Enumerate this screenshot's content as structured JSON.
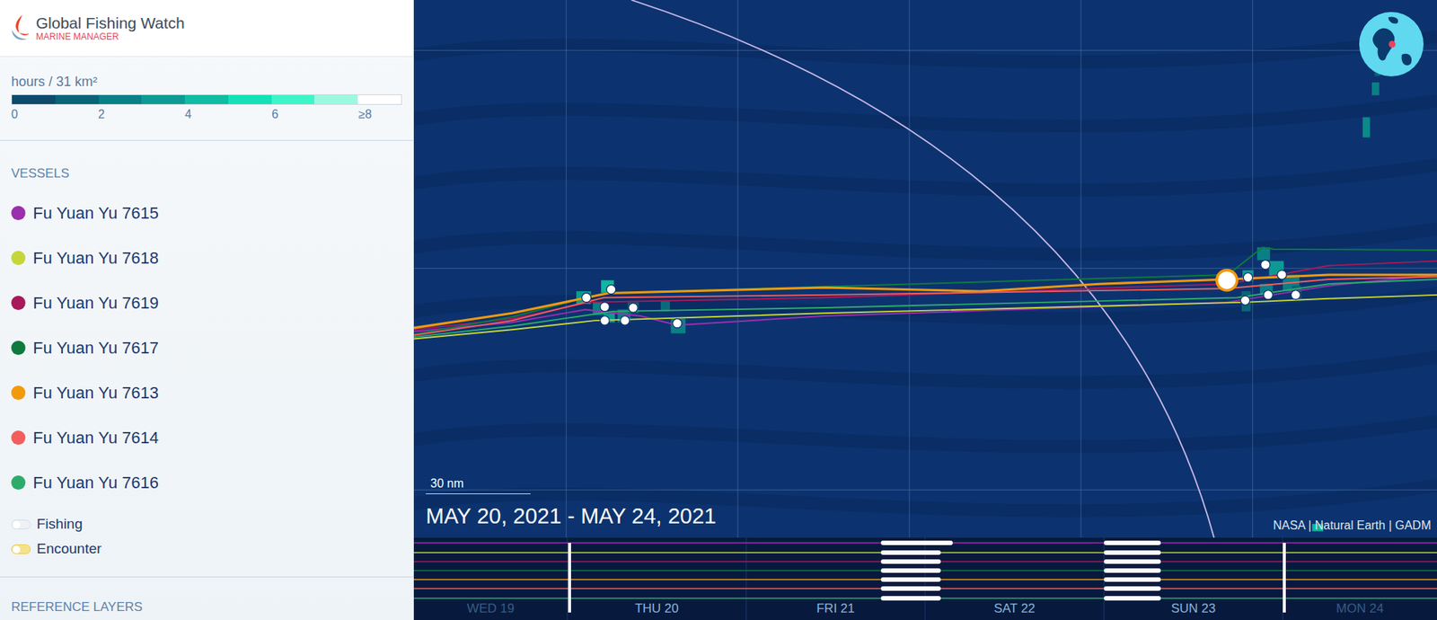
{
  "header": {
    "title": "Global Fishing Watch",
    "subtitle": "MARINE MANAGER"
  },
  "legend": {
    "unit": "hours / 31 km²",
    "ticks": [
      "0",
      "2",
      "4",
      "6",
      "≥8"
    ]
  },
  "vessels_heading": "VESSELS",
  "vessels": [
    {
      "name": "Fu Yuan Yu 7615",
      "color": "#9b2fae"
    },
    {
      "name": "Fu Yuan Yu 7618",
      "color": "#c6d63a"
    },
    {
      "name": "Fu Yuan Yu 7619",
      "color": "#a8195a"
    },
    {
      "name": "Fu Yuan Yu 7617",
      "color": "#0e7a3e"
    },
    {
      "name": "Fu Yuan Yu 7613",
      "color": "#f29a0c"
    },
    {
      "name": "Fu Yuan Yu 7614",
      "color": "#f25f5c"
    },
    {
      "name": "Fu Yuan Yu 7616",
      "color": "#2eab6a"
    }
  ],
  "toggles": [
    {
      "label": "Fishing",
      "on": false
    },
    {
      "label": "Encounter",
      "on": true
    }
  ],
  "reference_heading": "REFERENCE LAYERS",
  "map": {
    "date_range": "MAY 20, 2021 - MAY 24, 2021",
    "scale": "30 nm",
    "attribution": "NASA | Natural Earth | GADM"
  },
  "timeline": {
    "days": [
      {
        "label": "WED 19",
        "in_range": false
      },
      {
        "label": "THU 20",
        "in_range": true
      },
      {
        "label": "FRI 21",
        "in_range": true
      },
      {
        "label": "SAT 22",
        "in_range": true
      },
      {
        "label": "SUN 23",
        "in_range": true
      },
      {
        "label": "MON 24",
        "in_range": false
      }
    ]
  }
}
